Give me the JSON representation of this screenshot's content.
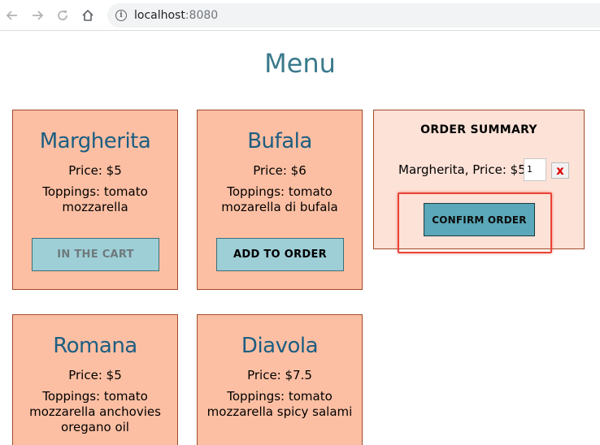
{
  "browser": {
    "url_host": "localhost",
    "url_port": ":8080",
    "icons": {
      "back": "arrow-left-icon",
      "forward": "arrow-right-icon",
      "reload": "reload-icon",
      "home": "home-icon",
      "info": "info-icon"
    }
  },
  "page": {
    "title": "Menu"
  },
  "colors": {
    "title": "#3a7a8c",
    "card_bg": "#fdbfa3",
    "card_border": "#a24a2a",
    "pizza_name": "#1c5e82",
    "button_bg": "#9ecfd7",
    "confirm_bg": "#5aa8b9",
    "summary_bg": "#fde2d7",
    "highlight": "#ea4335",
    "remove_x": "#e00000"
  },
  "menu": {
    "items": [
      {
        "name": "Margherita",
        "price": "Price: $5",
        "toppings": "Toppings: tomato mozzarella",
        "button": "IN THE CART",
        "in_cart": true
      },
      {
        "name": "Bufala",
        "price": "Price: $6",
        "toppings": "Toppings: tomato mozarella di bufala",
        "button": "ADD TO ORDER",
        "in_cart": false
      },
      {
        "name": "Romana",
        "price": "Price: $5",
        "toppings": "Toppings: tomato mozzarella anchovies oregano oil"
      },
      {
        "name": "Diavola",
        "price": "Price: $7.5",
        "toppings": "Toppings: tomato mozzarella spicy salami"
      }
    ]
  },
  "summary": {
    "title": "ORDER SUMMARY",
    "line": "Margherita, Price: $5",
    "quantity": "1",
    "remove_label": "x",
    "confirm_label": "CONFIRM ORDER"
  }
}
